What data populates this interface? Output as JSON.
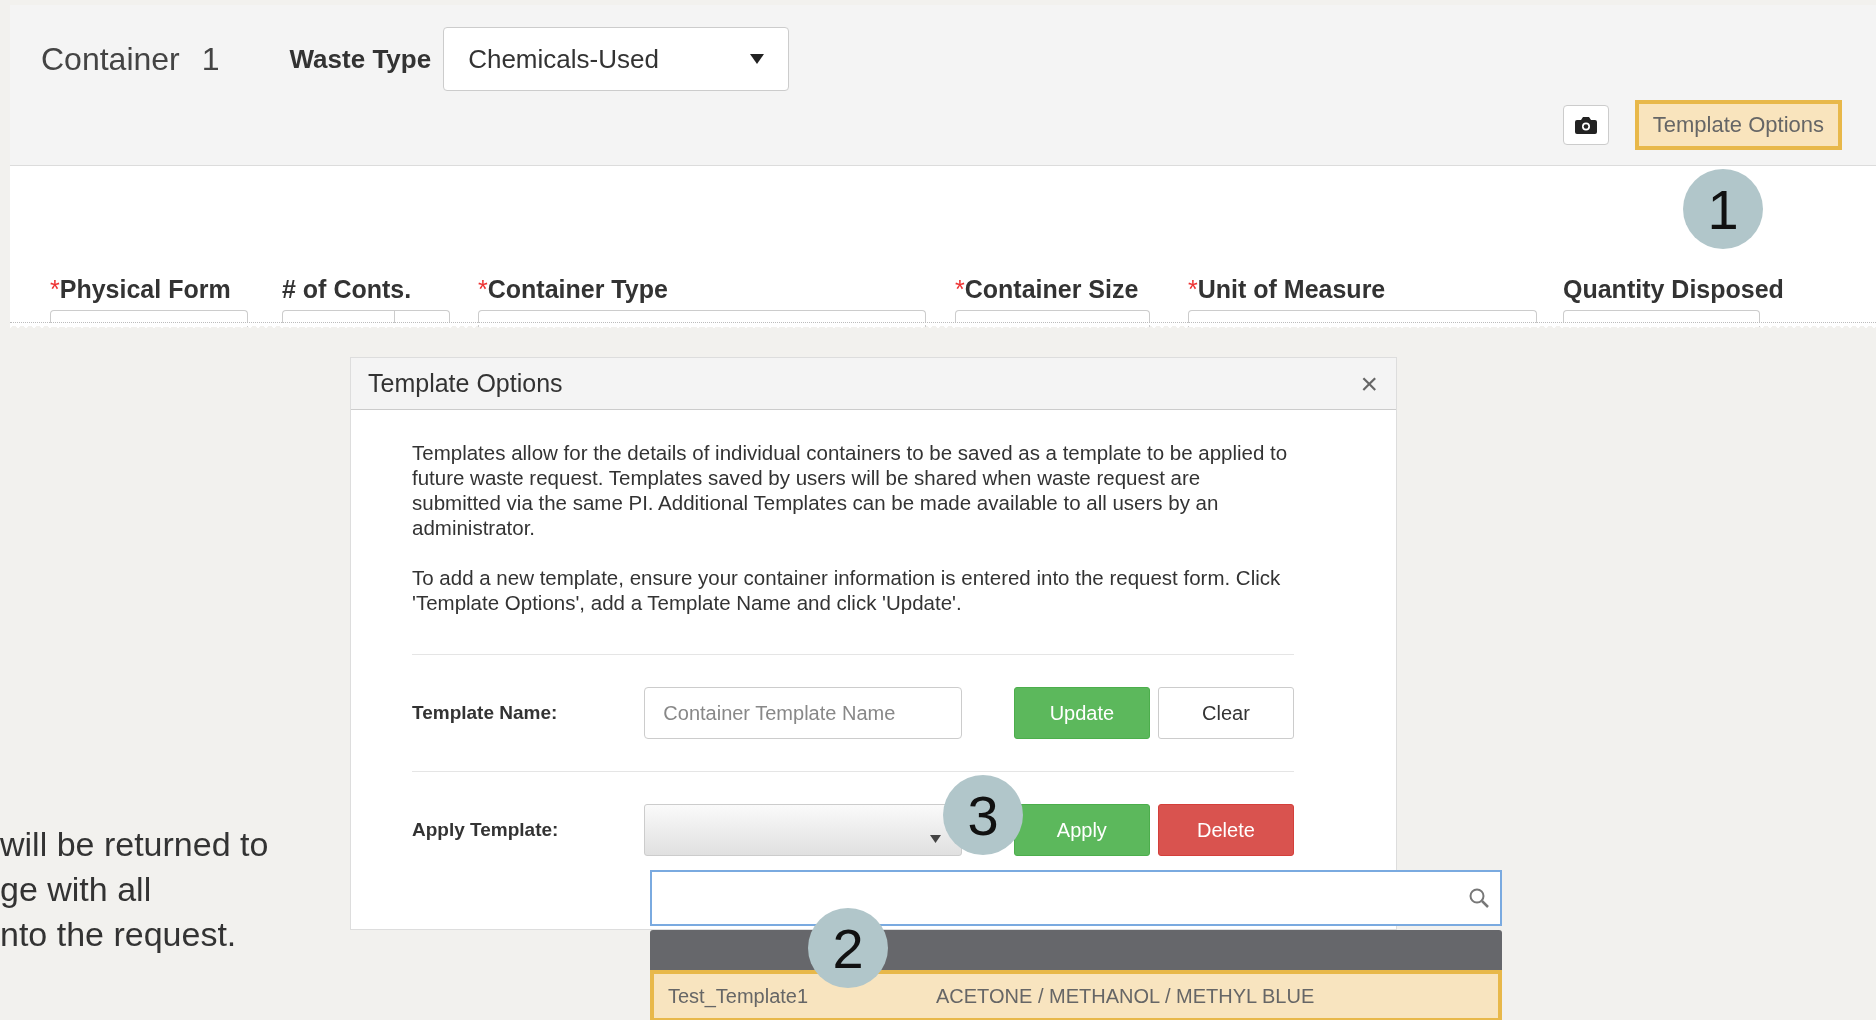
{
  "header": {
    "title": "Container",
    "number": "1",
    "waste_type_label": "Waste Type",
    "waste_type_value": "Chemicals-Used",
    "template_button": {
      "label": "Template Options",
      "highlighted": true
    }
  },
  "required_mark": "*",
  "fields": [
    {
      "label": "Physical Form",
      "required": true,
      "kind": "select"
    },
    {
      "label": "# of Conts.",
      "required": false,
      "kind": "spinner"
    },
    {
      "label": "Container Type",
      "required": true,
      "kind": "select"
    },
    {
      "label": "Container Size",
      "required": true,
      "kind": "select"
    },
    {
      "label": "Unit of Measure",
      "required": true,
      "kind": "select"
    },
    {
      "label": "Quantity Disposed",
      "required": false,
      "kind": "text"
    }
  ],
  "dialog": {
    "title": "Template Options",
    "close": "×",
    "paragraphs": [
      "Templates allow for the details of individual containers to be saved as a template to be applied to future waste request. Templates saved by users will be shared when waste request are submitted via the same PI. Additional Templates can be made available to all users by an administrator.",
      "To add a new template, ensure your container information is entered into the request form. Click 'Template Options', add a Template Name and click 'Update'."
    ],
    "name_label": "Template Name:",
    "name_placeholder": "Container Template Name",
    "update": "Update",
    "clear": "Clear",
    "apply_label": "Apply Template:",
    "apply": "Apply",
    "delete": "Delete"
  },
  "dropdown": {
    "options": [
      {
        "name": "Test_Template1",
        "chemicals": "ACETONE / METHANOL / METHYL BLUE",
        "selected": true
      }
    ]
  },
  "callouts": [
    "1",
    "3",
    "2"
  ],
  "side_text": [
    "will be returned to",
    "ge with all",
    "nto the request."
  ]
}
